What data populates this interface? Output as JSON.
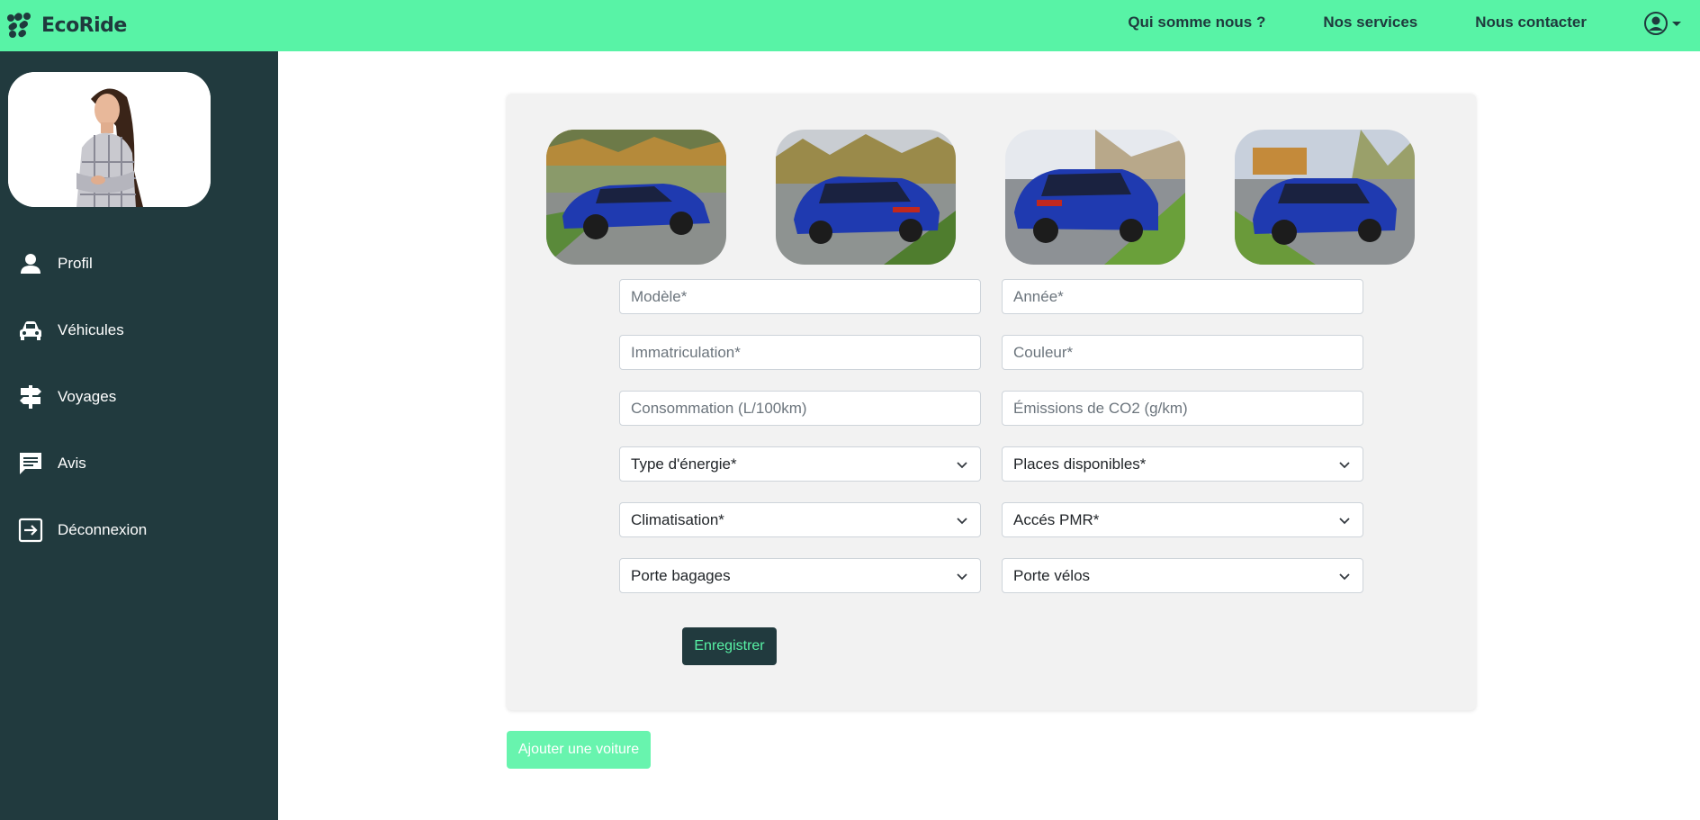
{
  "brand": {
    "name": "EcoRide"
  },
  "nav": {
    "links": [
      {
        "label": "Qui somme nous ?"
      },
      {
        "label": "Nos services"
      },
      {
        "label": "Nous contacter"
      }
    ]
  },
  "sidebar": {
    "items": [
      {
        "label": "Profil",
        "icon": "user-icon"
      },
      {
        "label": "Véhicules",
        "icon": "car-icon"
      },
      {
        "label": "Voyages",
        "icon": "signpost-icon"
      },
      {
        "label": "Avis",
        "icon": "message-icon"
      },
      {
        "label": "Déconnexion",
        "icon": "logout-icon"
      }
    ]
  },
  "form": {
    "model_placeholder": "Modèle*",
    "year_placeholder": "Année*",
    "plate_placeholder": "Immatriculation*",
    "color_placeholder": "Couleur*",
    "consumption_placeholder": "Consommation (L/100km)",
    "co2_placeholder": "Émissions de CO2 (g/km)",
    "energy_select": "Type d'énergie*",
    "seats_select": "Places disponibles*",
    "ac_select": "Climatisation*",
    "pmr_select": "Accés PMR*",
    "luggage_select": "Porte bagages",
    "bike_select": "Porte vélos",
    "save_label": "Enregistrer"
  },
  "actions": {
    "add_car_label": "Ajouter une voiture"
  },
  "colors": {
    "accent": "#58f3a6",
    "dark": "#213a3e",
    "card_bg": "#f2f2f2",
    "car_blue": "#1f3ab0"
  }
}
